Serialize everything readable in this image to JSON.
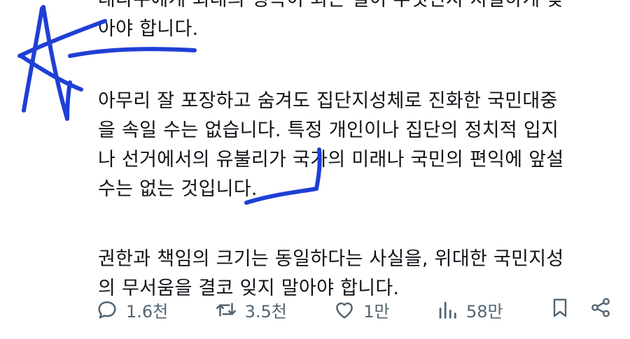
{
  "post": {
    "lines_block1": [
      "대다수에게 최대의 행복이 되는 길이 무엇인지 치열하게 찾",
      "아야 합니다."
    ],
    "lines_block2": [
      "아무리 잘 포장하고 숨겨도 집단지성체로 진화한 국민대중",
      "을 속일 수는 없습니다. 특정 개인이나 집단의 정치적 입지",
      "나 선거에서의 유불리가 국가의 미래나 국민의 편익에 앞설",
      "수는 없는 것입니다."
    ],
    "lines_block3": [
      "권한과 책임의 크기는 동일하다는 사실을, 위대한 국민지성",
      "의 무서움을 결코 잊지 말아야 합니다."
    ]
  },
  "actions": {
    "reply_count": "1.6천",
    "repost_count": "3.5천",
    "like_count": "1만",
    "view_count": "58만"
  },
  "icons": {
    "reply": "speech-bubble-icon",
    "repost": "repost-arrows-icon",
    "like": "heart-icon",
    "views": "bar-chart-icon",
    "bookmark": "bookmark-icon",
    "share": "share-icon"
  },
  "colors": {
    "text": "#0f1419",
    "muted": "#536471",
    "ink_annotation": "#1f3fd6"
  }
}
